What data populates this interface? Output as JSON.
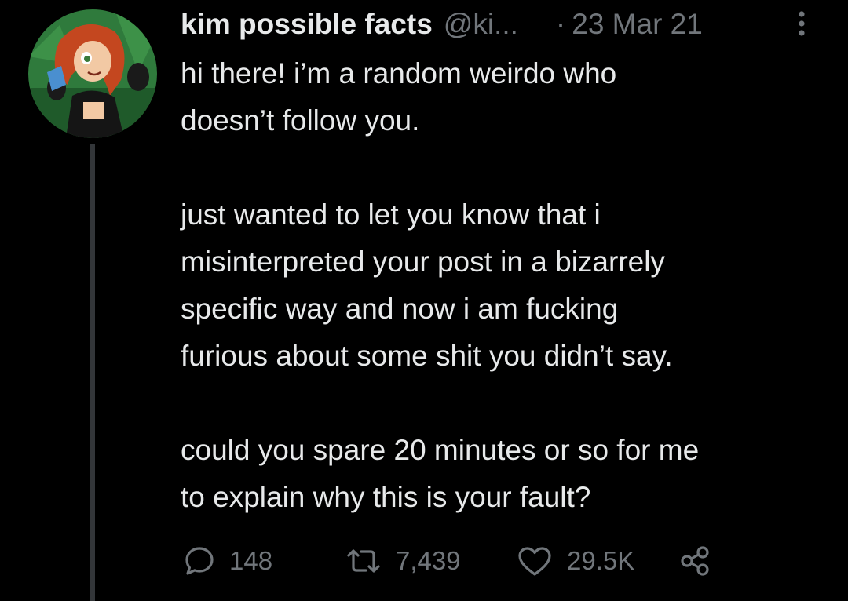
{
  "tweet": {
    "display_name": "kim possible facts",
    "handle": "@ki...",
    "separator": "·",
    "timestamp": "23 Mar 21",
    "body": {
      "p1_line1": "hi there! i’m a random weirdo who",
      "p1_line2": "doesn’t follow you.",
      "p2_line1": "just wanted to let you know that i",
      "p2_line2": "misinterpreted your post in a bizarrely",
      "p2_line3": "specific way and now i am fucking",
      "p2_line4": "furious about some shit you didn’t say.",
      "p3_line1": "could you spare 20 minutes or so for me",
      "p3_line2": "to explain why this is your fault?"
    },
    "stats": {
      "replies": "148",
      "retweets": "7,439",
      "likes": "29.5K"
    },
    "icons": {
      "more": "more-dots-icon",
      "reply": "reply-bubble-icon",
      "retweet": "retweet-icon",
      "like": "heart-icon",
      "share": "share-icon"
    },
    "colors": {
      "background": "#000000",
      "text": "#e7e9ea",
      "secondary": "#71767b",
      "thread_line": "#333639"
    }
  }
}
